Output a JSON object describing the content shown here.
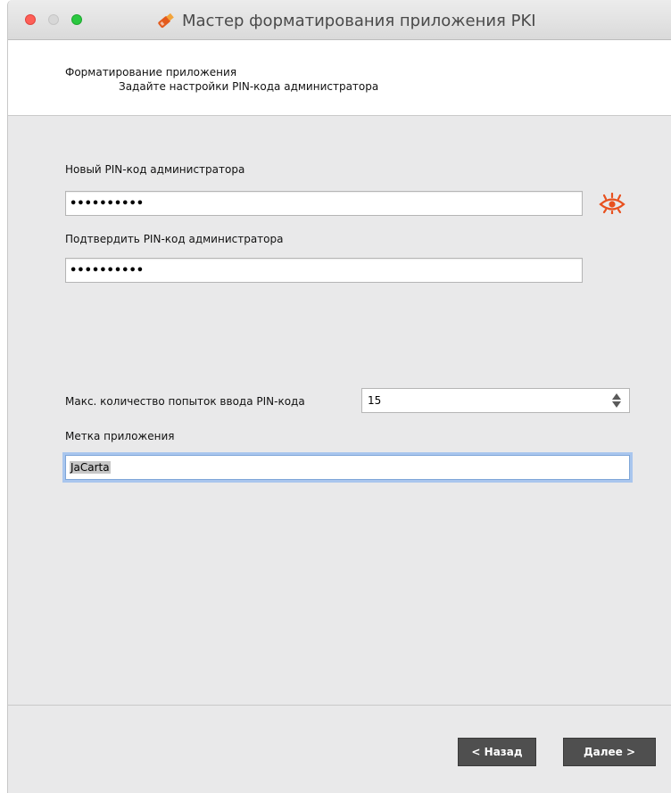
{
  "window": {
    "title": "Мастер форматирования приложения PKI"
  },
  "header": {
    "title": "Форматирование приложения",
    "subtitle": "Задайте настройки PIN-кода администратора"
  },
  "form": {
    "new_pin_label": "Новый PIN-код администратора",
    "new_pin_value": "••••••••••",
    "confirm_pin_label": "Подтвердить PIN-код администратора",
    "confirm_pin_value": "••••••••••",
    "max_attempts_label": "Макс. количество попыток ввода PIN-кода",
    "max_attempts_value": "15",
    "app_label_label": "Метка приложения",
    "app_label_value": "JaCarta"
  },
  "buttons": {
    "back": "< Назад",
    "next": "Далее >"
  },
  "colors": {
    "accent_eye": "#e8501e",
    "button_bg": "#4f4f4f",
    "focus_ring": "#a9c6ee"
  }
}
